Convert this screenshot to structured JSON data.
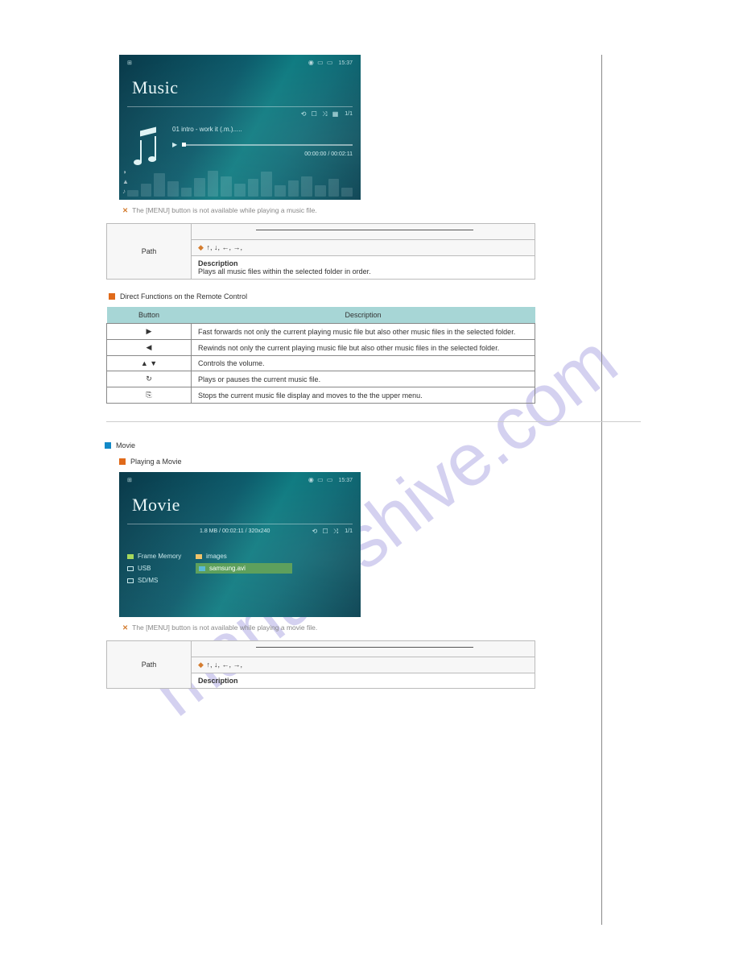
{
  "watermark_text": "manualshive.com",
  "music": {
    "status_time": "15:37",
    "title": "Music",
    "track_label": "01 intro - work it (.m.).....",
    "time_text": "00:00:00 / 00:02:11",
    "counter": "1/1"
  },
  "note1": "The [MENU] button is not available while playing a music file.",
  "table1": {
    "path_label": "Path",
    "path_value": "↑, ↓, ←, →,",
    "desc_label": "Description",
    "desc_value": "Plays all music files within the selected folder in order."
  },
  "remote_section_title": "Direct Functions on the Remote Control",
  "remote_table": {
    "h1": "Button",
    "h2": "Description",
    "rows": [
      {
        "btn": "▶",
        "desc": "Fast forwards not only the current playing music file but also other music files in the selected folder."
      },
      {
        "btn": "◀",
        "desc": "Rewinds not only the current playing music file but also other music files in the selected folder."
      },
      {
        "btn": "▲ ▼",
        "desc": "Controls the volume."
      },
      {
        "btn": "↻",
        "desc": "Plays or pauses the current music file."
      },
      {
        "btn": "⎘",
        "desc": "Stops the current music file display and moves to the the upper menu."
      }
    ]
  },
  "movie_header": "Movie",
  "play_movie_sub": "Playing a Movie",
  "movie": {
    "status_time": "15:37",
    "title": "Movie",
    "info_bar": "1.8 MB / 00:02:11 / 320x240",
    "counter": "1/1",
    "sources": [
      {
        "label": "Frame Memory",
        "active": true
      },
      {
        "label": "USB",
        "active": false
      },
      {
        "label": "SD/MS",
        "active": false
      }
    ],
    "folder": "images",
    "file": "samsung.avi"
  },
  "note2": "The [MENU] button is not available while playing a movie file.",
  "table2": {
    "path_label": "Path",
    "path_value": "↑, ↓, ←, →,",
    "desc_label": "Description",
    "desc_value": ""
  }
}
